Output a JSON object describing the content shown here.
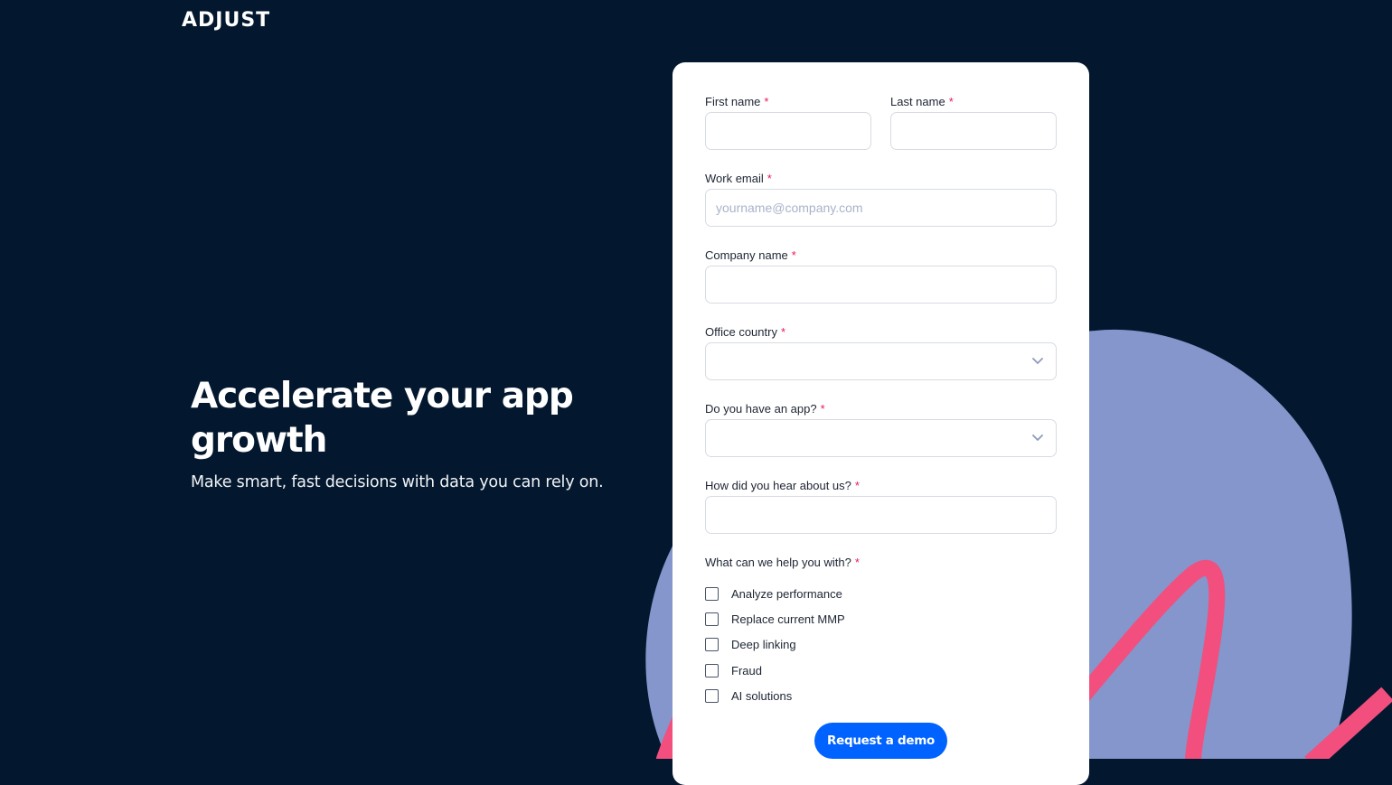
{
  "brand": {
    "logo_text": "ADJUST"
  },
  "hero": {
    "title_line1": "Accelerate your app",
    "title_line2": "growth",
    "subtitle": "Make smart, fast decisions with data you can rely on."
  },
  "form": {
    "required_mark": "*",
    "first_name": {
      "label": "First name",
      "value": ""
    },
    "last_name": {
      "label": "Last name",
      "value": ""
    },
    "work_email": {
      "label": "Work email",
      "value": "",
      "placeholder": "yourname@company.com"
    },
    "company_name": {
      "label": "Company name",
      "value": ""
    },
    "office_country": {
      "label": "Office country",
      "selected": ""
    },
    "has_app": {
      "label": "Do you have an app?",
      "selected": ""
    },
    "heard_about": {
      "label": "How did you hear about us?",
      "value": ""
    },
    "help_with": {
      "label": "What can we help you with?",
      "options": [
        {
          "label": "Analyze performance",
          "checked": false
        },
        {
          "label": "Replace current MMP",
          "checked": false
        },
        {
          "label": "Deep linking",
          "checked": false
        },
        {
          "label": "Fraud",
          "checked": false
        },
        {
          "label": "AI solutions",
          "checked": false
        }
      ]
    },
    "submit_label": "Request a demo"
  },
  "colors": {
    "background": "#03172e",
    "card": "#ffffff",
    "accent_blue": "#0062ff",
    "blob": "#8496cb",
    "ribbon": "#f24f7e",
    "required": "#e8195a"
  }
}
